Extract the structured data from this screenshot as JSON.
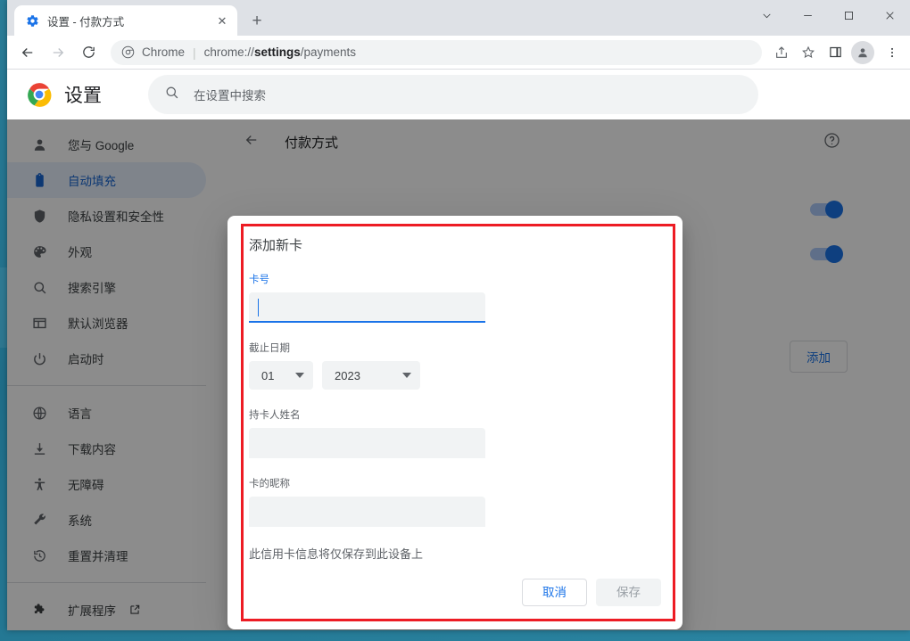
{
  "window": {
    "controls": [
      {
        "name": "tab-search",
        "glyph": "⌄"
      },
      {
        "name": "minimize",
        "glyph": "—"
      },
      {
        "name": "maximize",
        "glyph": "☐"
      },
      {
        "name": "close",
        "glyph": "✕"
      }
    ]
  },
  "tabs": [
    {
      "title": "设置 - 付款方式",
      "favicon": "gear-icon",
      "close_label": "✕"
    }
  ],
  "newtab": {
    "label": "+"
  },
  "toolbar": {
    "back_label": "←",
    "forward_label": "→",
    "reload_label": "⟳",
    "omnibox": {
      "brand": "Chrome",
      "separator": "|",
      "url_prefix": "chrome://",
      "url_bold": "settings",
      "url_suffix": "/payments"
    },
    "icons": [
      "share-icon",
      "bookmark-star-icon",
      "side-panel-icon",
      "profile-avatar-icon",
      "three-dot-menu-icon"
    ]
  },
  "settings": {
    "title": "设置",
    "search": {
      "placeholder": "在设置中搜索"
    },
    "sidebar": {
      "groups": [
        [
          {
            "label": "您与 Google",
            "icon": "person-icon",
            "selected": false
          },
          {
            "label": "自动填充",
            "icon": "clipboard-icon",
            "selected": true
          },
          {
            "label": "隐私设置和安全性",
            "icon": "shield-icon",
            "selected": false
          },
          {
            "label": "外观",
            "icon": "palette-icon",
            "selected": false
          },
          {
            "label": "搜索引擎",
            "icon": "search-icon",
            "selected": false
          },
          {
            "label": "默认浏览器",
            "icon": "browser-window-icon",
            "selected": false
          },
          {
            "label": "启动时",
            "icon": "power-icon",
            "selected": false
          }
        ],
        [
          {
            "label": "语言",
            "icon": "globe-icon",
            "selected": false
          },
          {
            "label": "下载内容",
            "icon": "download-icon",
            "selected": false
          },
          {
            "label": "无障碍",
            "icon": "accessibility-icon",
            "selected": false
          },
          {
            "label": "系统",
            "icon": "wrench-icon",
            "selected": false
          },
          {
            "label": "重置并清理",
            "icon": "restore-clock-icon",
            "selected": false
          }
        ],
        [
          {
            "label": "扩展程序",
            "icon": "puzzle-icon",
            "selected": false,
            "external": true
          }
        ]
      ]
    },
    "content": {
      "back_label": "←",
      "page_title": "付款方式",
      "help_label": "?",
      "add_button": "添加"
    }
  },
  "dialog": {
    "title": "添加新卡",
    "card_number": {
      "label": "卡号",
      "value": ""
    },
    "expiry": {
      "label": "截止日期",
      "month": "01",
      "year": "2023"
    },
    "card_holder": {
      "label": "持卡人姓名",
      "value": ""
    },
    "nickname": {
      "label": "卡的昵称",
      "value": ""
    },
    "note": "此信用卡信息将仅保存到此设备上",
    "cancel_label": "取消",
    "save_label": "保存"
  },
  "colors": {
    "accent_blue": "#1a73e8",
    "highlight_red": "#ed1c24",
    "field_gray": "#f1f3f4",
    "desktop_teal": "#2a7d98"
  }
}
